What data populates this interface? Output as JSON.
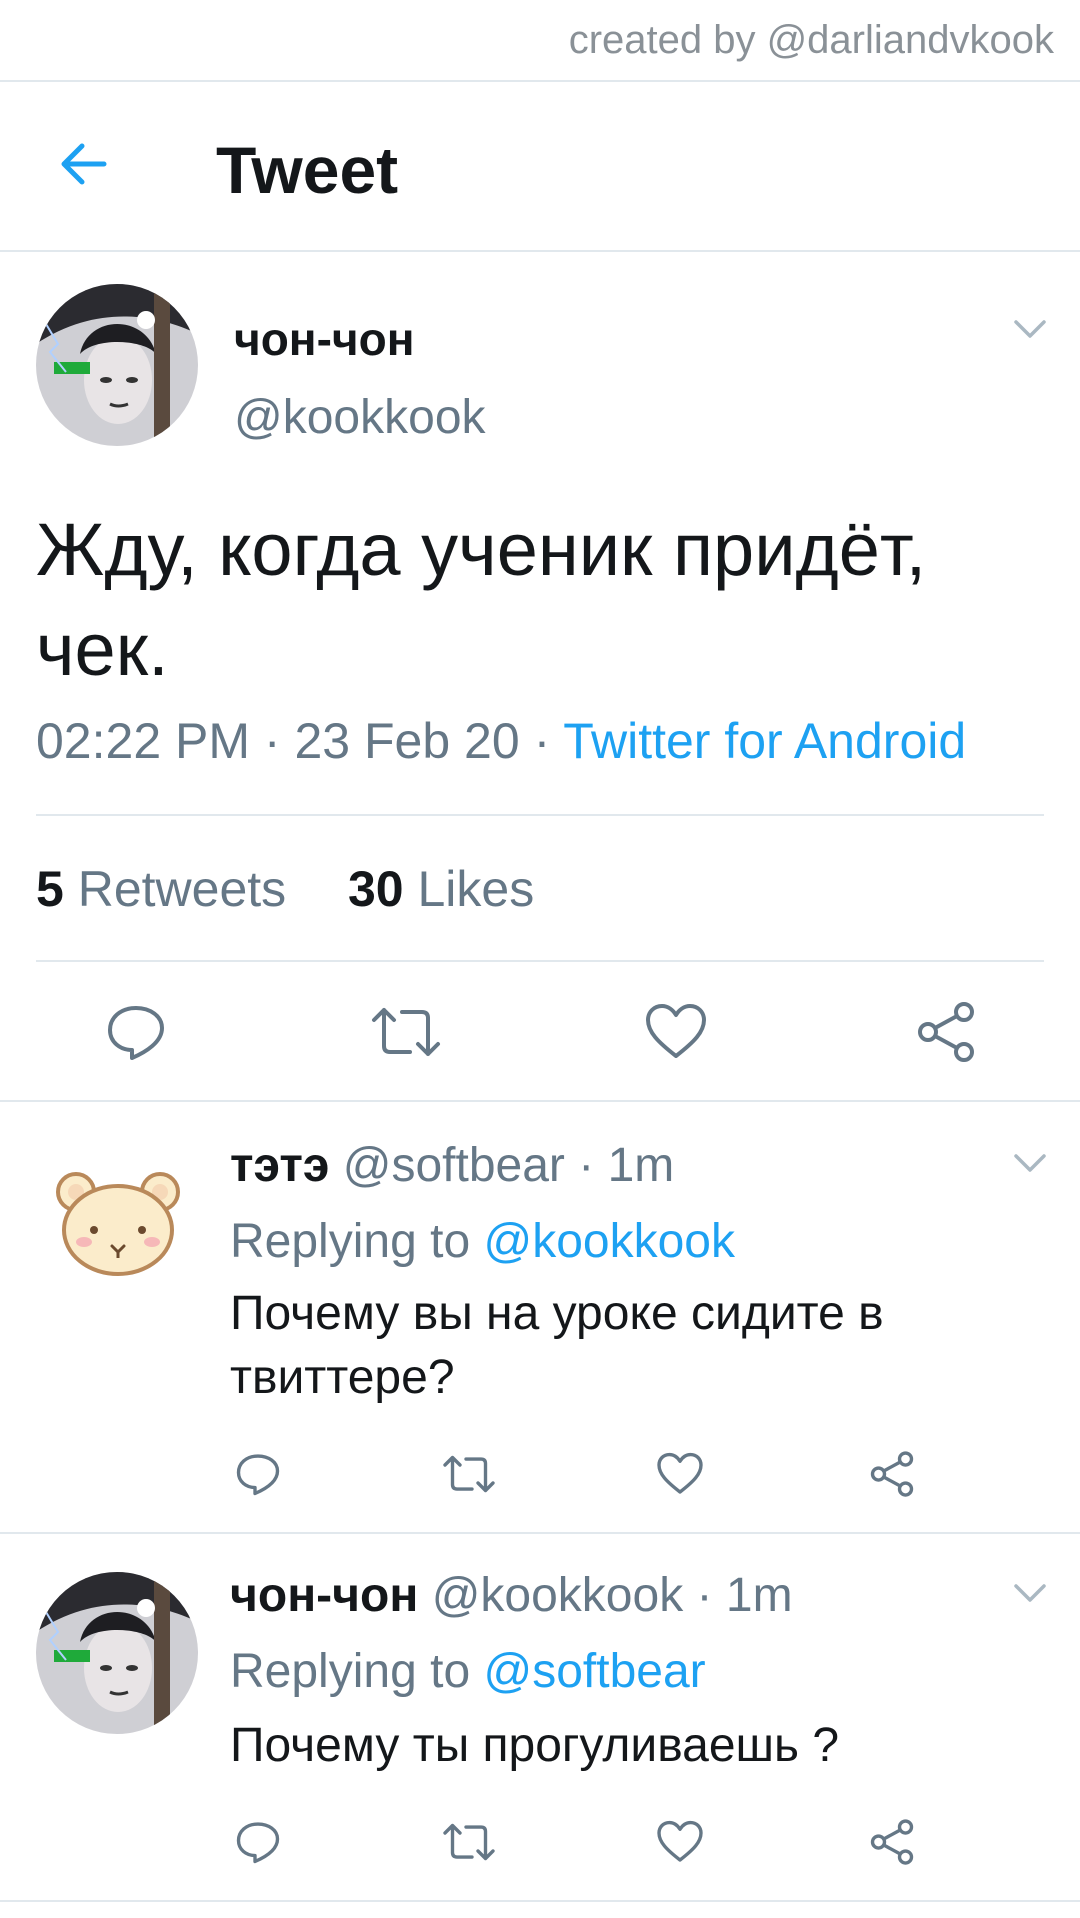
{
  "credit": "created by @darliandvkook",
  "header": {
    "title": "Tweet"
  },
  "tweet": {
    "name": "чон-чон",
    "handle": "@kookkook",
    "text_line1": "Жду, когда ученик придёт,",
    "text_line2": "чек.",
    "time": "02:22 PM",
    "date": "23 Feb 20",
    "source": "Twitter for Android",
    "retweets_count": "5",
    "retweets_label": "Retweets",
    "likes_count": "30",
    "likes_label": "Likes"
  },
  "replies": [
    {
      "name": "тэтэ",
      "handle": "@softbear",
      "time": "1m",
      "replying_label": "Replying to",
      "replying_to": "@kookkook",
      "text_line1": "Почему вы на уроке сидите в",
      "text_line2": "твиттере?"
    },
    {
      "name": "чон-чон",
      "handle": "@kookkook",
      "time": "1m",
      "replying_label": "Replying to",
      "replying_to": "@softbear",
      "text_line1": "Почему ты прогуливаешь ?"
    }
  ],
  "separator": "·",
  "colors": {
    "accent": "#1da1f2",
    "secondary_text": "#657786",
    "divider": "#e1e8ed"
  },
  "icons": [
    "back-arrow-icon",
    "chevron-down-icon",
    "reply-icon",
    "retweet-icon",
    "like-icon",
    "share-icon"
  ]
}
